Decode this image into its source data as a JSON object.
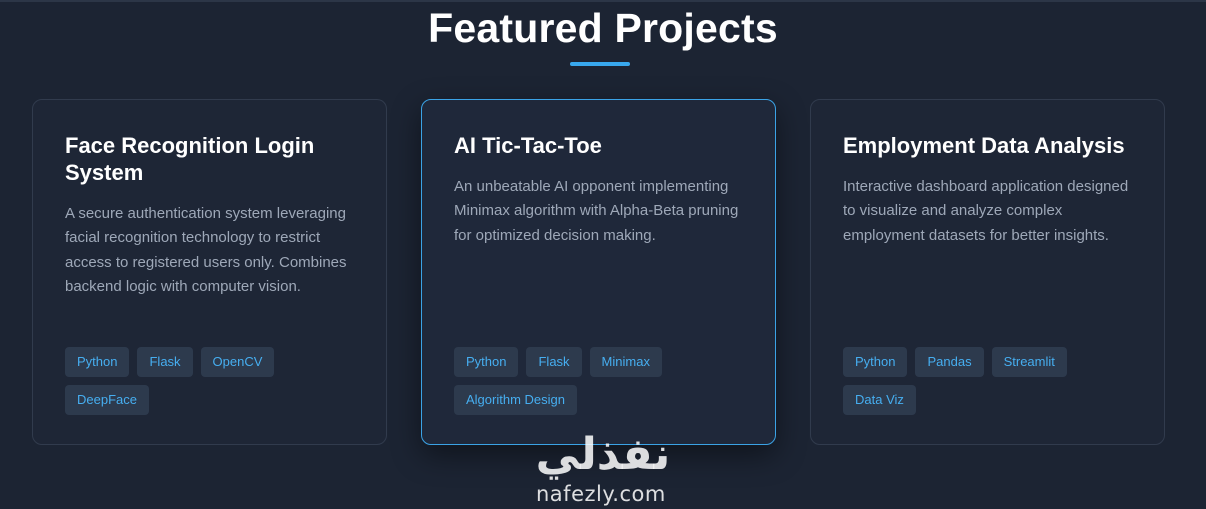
{
  "section": {
    "title": "Featured Projects"
  },
  "projects": [
    {
      "title": "Face Recognition Login System",
      "description": "A secure authentication system leveraging facial recognition technology to restrict access to registered users only. Combines backend logic with computer vision.",
      "tags": [
        "Python",
        "Flask",
        "OpenCV",
        "DeepFace"
      ]
    },
    {
      "title": "AI Tic-Tac-Toe",
      "description": "An unbeatable AI opponent implementing Minimax algorithm with Alpha-Beta pruning for optimized decision making.",
      "tags": [
        "Python",
        "Flask",
        "Minimax",
        "Algorithm Design"
      ]
    },
    {
      "title": "Employment Data Analysis",
      "description": "Interactive dashboard application designed to visualize and analyze complex employment datasets for better insights.",
      "tags": [
        "Python",
        "Pandas",
        "Streamlit",
        "Data Viz"
      ]
    }
  ],
  "watermark": {
    "arabic": "نفذلي",
    "latin": "nafezly.com"
  },
  "colors": {
    "background": "#1c2433",
    "accent": "#38a8ee",
    "tag_text": "#46aef0",
    "tag_bg": "#2d3a4d"
  }
}
